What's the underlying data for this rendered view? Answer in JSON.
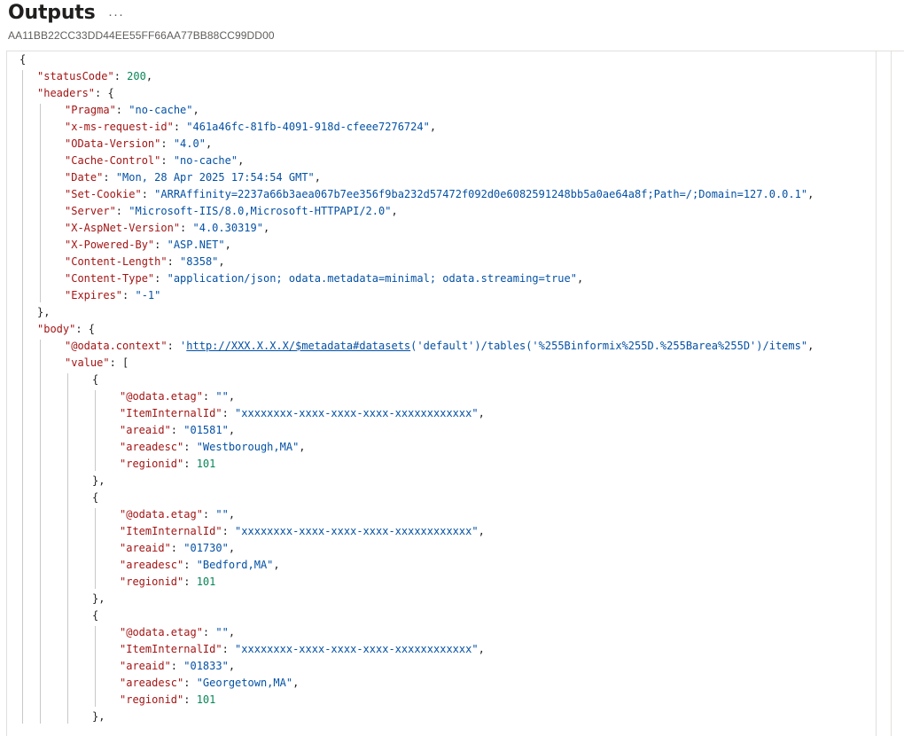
{
  "header": {
    "title": "Outputs",
    "more": "···",
    "run_id": "AA11BB22CC33DD44EE55FF66AA77BB88CC99DD00"
  },
  "json_lines": [
    {
      "indent": 0,
      "parts": [
        {
          "c": "p",
          "t": "{"
        }
      ]
    },
    {
      "indent": 1,
      "parts": [
        {
          "c": "k",
          "t": "\"statusCode\""
        },
        {
          "c": "p",
          "t": ": "
        },
        {
          "c": "n",
          "t": "200"
        },
        {
          "c": "p",
          "t": ","
        }
      ]
    },
    {
      "indent": 1,
      "parts": [
        {
          "c": "k",
          "t": "\"headers\""
        },
        {
          "c": "p",
          "t": ": {"
        }
      ]
    },
    {
      "indent": 2,
      "parts": [
        {
          "c": "k",
          "t": "\"Pragma\""
        },
        {
          "c": "p",
          "t": ": "
        },
        {
          "c": "s",
          "t": "\"no-cache\""
        },
        {
          "c": "p",
          "t": ","
        }
      ]
    },
    {
      "indent": 2,
      "parts": [
        {
          "c": "k",
          "t": "\"x-ms-request-id\""
        },
        {
          "c": "p",
          "t": ": "
        },
        {
          "c": "s",
          "t": "\"461a46fc-81fb-4091-918d-cfeee7276724\""
        },
        {
          "c": "p",
          "t": ","
        }
      ]
    },
    {
      "indent": 2,
      "parts": [
        {
          "c": "k",
          "t": "\"OData-Version\""
        },
        {
          "c": "p",
          "t": ": "
        },
        {
          "c": "s",
          "t": "\"4.0\""
        },
        {
          "c": "p",
          "t": ","
        }
      ]
    },
    {
      "indent": 2,
      "parts": [
        {
          "c": "k",
          "t": "\"Cache-Control\""
        },
        {
          "c": "p",
          "t": ": "
        },
        {
          "c": "s",
          "t": "\"no-cache\""
        },
        {
          "c": "p",
          "t": ","
        }
      ]
    },
    {
      "indent": 2,
      "parts": [
        {
          "c": "k",
          "t": "\"Date\""
        },
        {
          "c": "p",
          "t": ": "
        },
        {
          "c": "s",
          "t": "\"Mon, 28 Apr 2025 17:54:54 GMT\""
        },
        {
          "c": "p",
          "t": ","
        }
      ]
    },
    {
      "indent": 2,
      "parts": [
        {
          "c": "k",
          "t": "\"Set-Cookie\""
        },
        {
          "c": "p",
          "t": ": "
        },
        {
          "c": "s",
          "t": "\"ARRAffinity=2237a66b3aea067b7ee356f9ba232d57472f092d0e6082591248bb5a0ae64a8f;Path=/;Domain=127.0.0.1\""
        },
        {
          "c": "p",
          "t": ","
        }
      ]
    },
    {
      "indent": 2,
      "parts": [
        {
          "c": "k",
          "t": "\"Server\""
        },
        {
          "c": "p",
          "t": ": "
        },
        {
          "c": "s",
          "t": "\"Microsoft-IIS/8.0,Microsoft-HTTPAPI/2.0\""
        },
        {
          "c": "p",
          "t": ","
        }
      ]
    },
    {
      "indent": 2,
      "parts": [
        {
          "c": "k",
          "t": "\"X-AspNet-Version\""
        },
        {
          "c": "p",
          "t": ": "
        },
        {
          "c": "s",
          "t": "\"4.0.30319\""
        },
        {
          "c": "p",
          "t": ","
        }
      ]
    },
    {
      "indent": 2,
      "parts": [
        {
          "c": "k",
          "t": "\"X-Powered-By\""
        },
        {
          "c": "p",
          "t": ": "
        },
        {
          "c": "s",
          "t": "\"ASP.NET\""
        },
        {
          "c": "p",
          "t": ","
        }
      ]
    },
    {
      "indent": 2,
      "parts": [
        {
          "c": "k",
          "t": "\"Content-Length\""
        },
        {
          "c": "p",
          "t": ": "
        },
        {
          "c": "s",
          "t": "\"8358\""
        },
        {
          "c": "p",
          "t": ","
        }
      ]
    },
    {
      "indent": 2,
      "parts": [
        {
          "c": "k",
          "t": "\"Content-Type\""
        },
        {
          "c": "p",
          "t": ": "
        },
        {
          "c": "s",
          "t": "\"application/json; odata.metadata=minimal; odata.streaming=true\""
        },
        {
          "c": "p",
          "t": ","
        }
      ]
    },
    {
      "indent": 2,
      "parts": [
        {
          "c": "k",
          "t": "\"Expires\""
        },
        {
          "c": "p",
          "t": ": "
        },
        {
          "c": "s",
          "t": "\"-1\""
        }
      ]
    },
    {
      "indent": 1,
      "parts": [
        {
          "c": "p",
          "t": "},"
        }
      ]
    },
    {
      "indent": 1,
      "parts": [
        {
          "c": "k",
          "t": "\"body\""
        },
        {
          "c": "p",
          "t": ": {"
        }
      ]
    },
    {
      "indent": 2,
      "parts": [
        {
          "c": "k",
          "t": "\"@odata.context\""
        },
        {
          "c": "p",
          "t": ": "
        },
        {
          "c": "s",
          "t": "'"
        },
        {
          "c": "link",
          "t": "http://XXX.X.X.X/$metadata#datasets"
        },
        {
          "c": "s",
          "t": "('default')/tables('%255Binformix%255D.%255Barea%255D')/items\""
        },
        {
          "c": "p",
          "t": ","
        }
      ]
    },
    {
      "indent": 2,
      "parts": [
        {
          "c": "k",
          "t": "\"value\""
        },
        {
          "c": "p",
          "t": ": ["
        }
      ]
    },
    {
      "indent": 3,
      "parts": [
        {
          "c": "p",
          "t": "{"
        }
      ]
    },
    {
      "indent": 4,
      "parts": [
        {
          "c": "k",
          "t": "\"@odata.etag\""
        },
        {
          "c": "p",
          "t": ": "
        },
        {
          "c": "s",
          "t": "\"\""
        },
        {
          "c": "p",
          "t": ","
        }
      ]
    },
    {
      "indent": 4,
      "parts": [
        {
          "c": "k",
          "t": "\"ItemInternalId\""
        },
        {
          "c": "p",
          "t": ": "
        },
        {
          "c": "s",
          "t": "\"xxxxxxxx-xxxx-xxxx-xxxx-xxxxxxxxxxxx\""
        },
        {
          "c": "p",
          "t": ","
        }
      ]
    },
    {
      "indent": 4,
      "parts": [
        {
          "c": "k",
          "t": "\"areaid\""
        },
        {
          "c": "p",
          "t": ": "
        },
        {
          "c": "s",
          "t": "\"01581\""
        },
        {
          "c": "p",
          "t": ","
        }
      ]
    },
    {
      "indent": 4,
      "parts": [
        {
          "c": "k",
          "t": "\"areadesc\""
        },
        {
          "c": "p",
          "t": ": "
        },
        {
          "c": "s",
          "t": "\"Westborough,MA\""
        },
        {
          "c": "p",
          "t": ","
        }
      ]
    },
    {
      "indent": 4,
      "parts": [
        {
          "c": "k",
          "t": "\"regionid\""
        },
        {
          "c": "p",
          "t": ": "
        },
        {
          "c": "n",
          "t": "101"
        }
      ]
    },
    {
      "indent": 3,
      "parts": [
        {
          "c": "p",
          "t": "},"
        }
      ]
    },
    {
      "indent": 3,
      "parts": [
        {
          "c": "p",
          "t": "{"
        }
      ]
    },
    {
      "indent": 4,
      "parts": [
        {
          "c": "k",
          "t": "\"@odata.etag\""
        },
        {
          "c": "p",
          "t": ": "
        },
        {
          "c": "s",
          "t": "\"\""
        },
        {
          "c": "p",
          "t": ","
        }
      ]
    },
    {
      "indent": 4,
      "parts": [
        {
          "c": "k",
          "t": "\"ItemInternalId\""
        },
        {
          "c": "p",
          "t": ": "
        },
        {
          "c": "s",
          "t": "\"xxxxxxxx-xxxx-xxxx-xxxx-xxxxxxxxxxxx\""
        },
        {
          "c": "p",
          "t": ","
        }
      ]
    },
    {
      "indent": 4,
      "parts": [
        {
          "c": "k",
          "t": "\"areaid\""
        },
        {
          "c": "p",
          "t": ": "
        },
        {
          "c": "s",
          "t": "\"01730\""
        },
        {
          "c": "p",
          "t": ","
        }
      ]
    },
    {
      "indent": 4,
      "parts": [
        {
          "c": "k",
          "t": "\"areadesc\""
        },
        {
          "c": "p",
          "t": ": "
        },
        {
          "c": "s",
          "t": "\"Bedford,MA\""
        },
        {
          "c": "p",
          "t": ","
        }
      ]
    },
    {
      "indent": 4,
      "parts": [
        {
          "c": "k",
          "t": "\"regionid\""
        },
        {
          "c": "p",
          "t": ": "
        },
        {
          "c": "n",
          "t": "101"
        }
      ]
    },
    {
      "indent": 3,
      "parts": [
        {
          "c": "p",
          "t": "},"
        }
      ]
    },
    {
      "indent": 3,
      "parts": [
        {
          "c": "p",
          "t": "{"
        }
      ]
    },
    {
      "indent": 4,
      "parts": [
        {
          "c": "k",
          "t": "\"@odata.etag\""
        },
        {
          "c": "p",
          "t": ": "
        },
        {
          "c": "s",
          "t": "\"\""
        },
        {
          "c": "p",
          "t": ","
        }
      ]
    },
    {
      "indent": 4,
      "parts": [
        {
          "c": "k",
          "t": "\"ItemInternalId\""
        },
        {
          "c": "p",
          "t": ": "
        },
        {
          "c": "s",
          "t": "\"xxxxxxxx-xxxx-xxxx-xxxx-xxxxxxxxxxxx\""
        },
        {
          "c": "p",
          "t": ","
        }
      ]
    },
    {
      "indent": 4,
      "parts": [
        {
          "c": "k",
          "t": "\"areaid\""
        },
        {
          "c": "p",
          "t": ": "
        },
        {
          "c": "s",
          "t": "\"01833\""
        },
        {
          "c": "p",
          "t": ","
        }
      ]
    },
    {
      "indent": 4,
      "parts": [
        {
          "c": "k",
          "t": "\"areadesc\""
        },
        {
          "c": "p",
          "t": ": "
        },
        {
          "c": "s",
          "t": "\"Georgetown,MA\""
        },
        {
          "c": "p",
          "t": ","
        }
      ]
    },
    {
      "indent": 4,
      "parts": [
        {
          "c": "k",
          "t": "\"regionid\""
        },
        {
          "c": "p",
          "t": ": "
        },
        {
          "c": "n",
          "t": "101"
        }
      ]
    },
    {
      "indent": 3,
      "parts": [
        {
          "c": "p",
          "t": "},"
        }
      ]
    }
  ]
}
